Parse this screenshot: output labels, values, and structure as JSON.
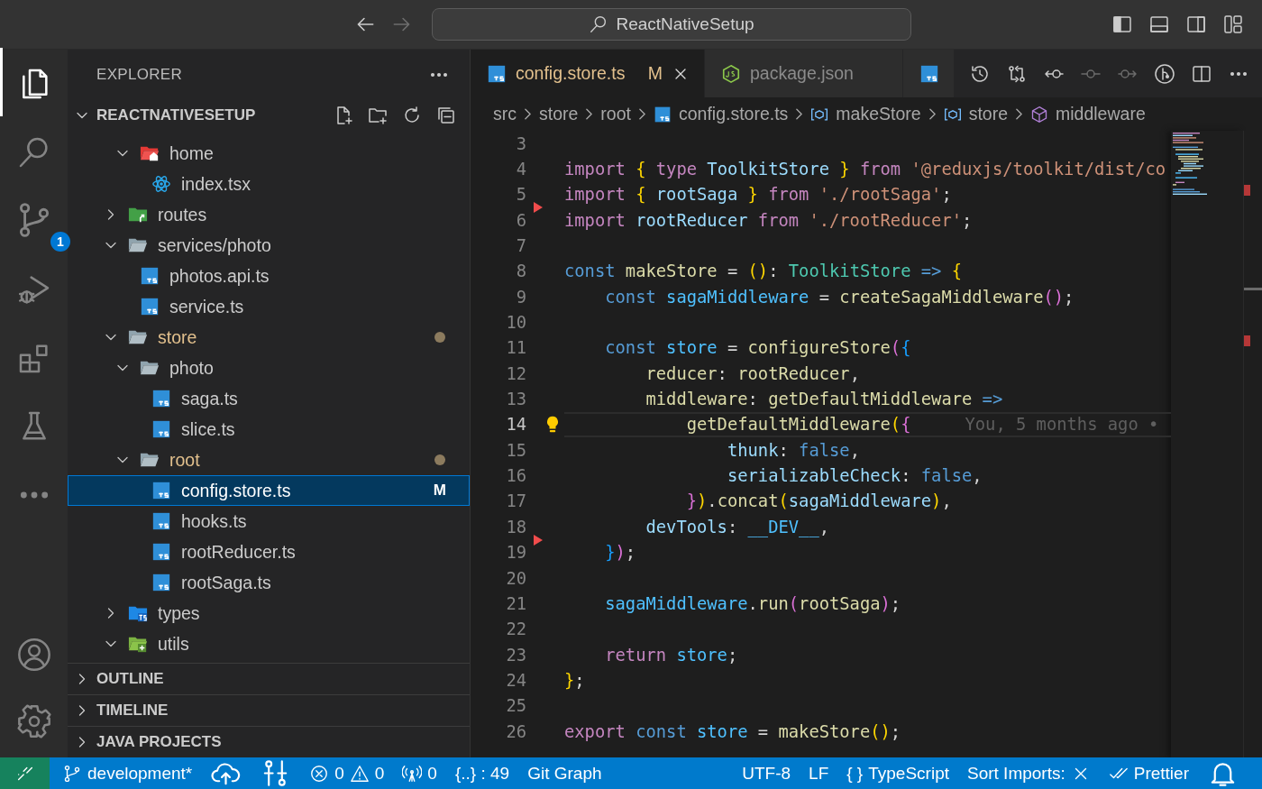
{
  "title_bar": {
    "nav": [
      {
        "kind": "back",
        "disabled": false
      },
      {
        "kind": "forward",
        "disabled": true
      }
    ],
    "command_center": "ReactNativeSetup",
    "layout_toggles": [
      {
        "kind": "primary-sidebar",
        "on": true
      },
      {
        "kind": "panel",
        "on": false
      },
      {
        "kind": "secondary-sidebar",
        "on": false
      },
      {
        "kind": "customize",
        "on": false
      }
    ]
  },
  "activity_bar": {
    "items": [
      {
        "kind": "explorer",
        "selected": true
      },
      {
        "kind": "search",
        "selected": false
      },
      {
        "kind": "source-control",
        "selected": false,
        "badge": "1"
      },
      {
        "kind": "run-debug",
        "selected": false
      },
      {
        "kind": "extensions",
        "selected": false
      },
      {
        "kind": "testing",
        "selected": false
      },
      {
        "kind": "more",
        "selected": false
      }
    ],
    "bottom": [
      {
        "kind": "account"
      },
      {
        "kind": "settings"
      }
    ]
  },
  "sidebar": {
    "title": "EXPLORER",
    "folder": {
      "title": "REACTNATIVESETUP",
      "expanded": true
    },
    "tree": [
      {
        "children": [
          {
            "name": "home",
            "kind": "home-folder",
            "expanded": true,
            "selected": false,
            "modified": false,
            "children": [
              {
                "name": "index.tsx",
                "kind": "react-file",
                "selected": false,
                "modified": false
              }
            ]
          }
        ]
      },
      {
        "name": "routes",
        "kind": "routes-folder",
        "expanded": false,
        "selected": false,
        "modified": false
      },
      {
        "name": "services/photo",
        "kind": "folder",
        "expanded": true,
        "selected": false,
        "modified": false,
        "children": [
          {
            "name": "photos.api.ts",
            "kind": "ts-file",
            "selected": false,
            "modified": false
          },
          {
            "name": "service.ts",
            "kind": "ts-file",
            "selected": false,
            "modified": false
          }
        ]
      },
      {
        "name": "store",
        "kind": "folder",
        "expanded": true,
        "selected": false,
        "modified": true,
        "children": [
          {
            "name": "photo",
            "kind": "folder",
            "expanded": true,
            "selected": false,
            "modified": false,
            "children": [
              {
                "name": "saga.ts",
                "kind": "ts-file",
                "selected": false,
                "modified": false
              },
              {
                "name": "slice.ts",
                "kind": "ts-file",
                "selected": false,
                "modified": false
              }
            ]
          },
          {
            "name": "root",
            "kind": "folder",
            "expanded": true,
            "selected": false,
            "modified": true,
            "children": [
              {
                "name": "config.store.ts",
                "kind": "ts-file",
                "selected": true,
                "modified": true,
                "badge": "M"
              },
              {
                "name": "hooks.ts",
                "kind": "ts-file",
                "selected": false,
                "modified": false
              },
              {
                "name": "rootReducer.ts",
                "kind": "ts-file",
                "selected": false,
                "modified": false
              },
              {
                "name": "rootSaga.ts",
                "kind": "ts-file",
                "selected": false,
                "modified": false
              }
            ]
          }
        ]
      },
      {
        "name": "types",
        "kind": "types-folder",
        "expanded": false,
        "selected": false,
        "modified": false
      },
      {
        "name": "utils",
        "kind": "utils-folder",
        "expanded": true,
        "selected": false,
        "modified": false
      }
    ],
    "sections": [
      {
        "title": "OUTLINE",
        "expanded": false
      },
      {
        "title": "TIMELINE",
        "expanded": false
      },
      {
        "title": "JAVA PROJECTS",
        "expanded": false
      }
    ]
  },
  "editor": {
    "tabs": [
      {
        "kind": "ts",
        "label": "config.store.ts",
        "status": "M",
        "modified": true,
        "selected": true
      },
      {
        "kind": "node",
        "label": "package.json",
        "modified": false,
        "selected": false
      },
      {
        "kind": "ts",
        "selected": false
      }
    ],
    "actions": [
      {
        "kind": "history",
        "disabled": false
      },
      {
        "kind": "compare",
        "disabled": false
      },
      {
        "kind": "git-back",
        "disabled": false
      },
      {
        "kind": "git-previous",
        "disabled": true
      },
      {
        "kind": "git-next",
        "disabled": true
      },
      {
        "kind": "git-graph",
        "disabled": false
      },
      {
        "kind": "split",
        "disabled": false
      },
      {
        "kind": "more",
        "disabled": false
      }
    ],
    "breadcrumbs": [
      {
        "kind": "folder",
        "text": "src"
      },
      {
        "kind": "folder",
        "text": "store"
      },
      {
        "kind": "folder",
        "text": "root"
      },
      {
        "kind": "ts",
        "text": "config.store.ts"
      },
      {
        "kind": "variable",
        "text": "makeStore"
      },
      {
        "kind": "variable",
        "text": "store"
      },
      {
        "kind": "method",
        "text": "middleware"
      }
    ],
    "lines": [
      {
        "number": "3",
        "current": false,
        "deleted_below": false
      },
      {
        "number": "4",
        "current": false,
        "deleted_below": false,
        "tokens": [
          {
            "kind": "ctl",
            "text": "import "
          },
          {
            "kind": "b1",
            "text": "{ "
          },
          {
            "kind": "ctl",
            "text": "type "
          },
          {
            "kind": "var",
            "text": "ToolkitStore "
          },
          {
            "kind": "b1",
            "text": "} "
          },
          {
            "kind": "ctl",
            "text": "from "
          },
          {
            "kind": "str",
            "text": "'@reduxjs/toolkit/dist/co"
          }
        ]
      },
      {
        "number": "5",
        "current": false,
        "deleted_below": true,
        "tokens": [
          {
            "kind": "ctl",
            "text": "import "
          },
          {
            "kind": "b1",
            "text": "{ "
          },
          {
            "kind": "var",
            "text": "rootSaga "
          },
          {
            "kind": "b1",
            "text": "} "
          },
          {
            "kind": "ctl",
            "text": "from "
          },
          {
            "kind": "str",
            "text": "'./rootSaga'"
          },
          {
            "kind": "p",
            "text": ";"
          }
        ]
      },
      {
        "number": "6",
        "current": false,
        "deleted_below": false,
        "tokens": [
          {
            "kind": "ctl",
            "text": "import "
          },
          {
            "kind": "var",
            "text": "rootReducer "
          },
          {
            "kind": "ctl",
            "text": "from "
          },
          {
            "kind": "str",
            "text": "'./rootReducer'"
          },
          {
            "kind": "p",
            "text": ";"
          }
        ]
      },
      {
        "number": "7",
        "current": false,
        "deleted_below": false
      },
      {
        "number": "8",
        "current": false,
        "deleted_below": false,
        "tokens": [
          {
            "kind": "kw",
            "text": "const "
          },
          {
            "kind": "fn",
            "text": "makeStore "
          },
          {
            "kind": "p",
            "text": "= "
          },
          {
            "kind": "b1",
            "text": "()"
          },
          {
            "kind": "p",
            "text": ": "
          },
          {
            "kind": "type",
            "text": "ToolkitStore "
          },
          {
            "kind": "kw",
            "text": "=> "
          },
          {
            "kind": "b1",
            "text": "{"
          }
        ]
      },
      {
        "number": "9",
        "current": false,
        "deleted_below": false,
        "tokens": [
          {
            "kind": "kw",
            "text": "    const "
          },
          {
            "kind": "const",
            "text": "sagaMiddleware "
          },
          {
            "kind": "p",
            "text": "= "
          },
          {
            "kind": "fn",
            "text": "createSagaMiddleware"
          },
          {
            "kind": "b2",
            "text": "()"
          },
          {
            "kind": "p",
            "text": ";"
          }
        ]
      },
      {
        "number": "10",
        "current": false,
        "deleted_below": false
      },
      {
        "number": "11",
        "current": false,
        "deleted_below": false,
        "tokens": [
          {
            "kind": "kw",
            "text": "    const "
          },
          {
            "kind": "const",
            "text": "store "
          },
          {
            "kind": "p",
            "text": "= "
          },
          {
            "kind": "fn",
            "text": "configureStore"
          },
          {
            "kind": "b2",
            "text": "("
          },
          {
            "kind": "b3",
            "text": "{"
          }
        ]
      },
      {
        "number": "12",
        "current": false,
        "deleted_below": false,
        "tokens": [
          {
            "kind": "fn",
            "text": "        reducer"
          },
          {
            "kind": "p",
            "text": ": "
          },
          {
            "kind": "fn",
            "text": "rootReducer"
          },
          {
            "kind": "p",
            "text": ","
          }
        ]
      },
      {
        "number": "13",
        "current": false,
        "deleted_below": false,
        "tokens": [
          {
            "kind": "fn",
            "text": "        middleware"
          },
          {
            "kind": "p",
            "text": ": "
          },
          {
            "kind": "fn",
            "text": "getDefaultMiddleware "
          },
          {
            "kind": "kw",
            "text": "=>"
          }
        ]
      },
      {
        "number": "14",
        "current": true,
        "deleted_below": false,
        "blame": "You, 5 months ago •",
        "tokens": [
          {
            "kind": "fn",
            "text": "            getDefaultMiddleware"
          },
          {
            "kind": "b1",
            "text": "("
          },
          {
            "kind": "b2",
            "text": "{"
          }
        ]
      },
      {
        "number": "15",
        "current": false,
        "deleted_below": false,
        "tokens": [
          {
            "kind": "var",
            "text": "                thunk"
          },
          {
            "kind": "p",
            "text": ": "
          },
          {
            "kind": "kw",
            "text": "false"
          },
          {
            "kind": "p",
            "text": ","
          }
        ]
      },
      {
        "number": "16",
        "current": false,
        "deleted_below": false,
        "tokens": [
          {
            "kind": "var",
            "text": "                serializableCheck"
          },
          {
            "kind": "p",
            "text": ": "
          },
          {
            "kind": "kw",
            "text": "false"
          },
          {
            "kind": "p",
            "text": ","
          }
        ]
      },
      {
        "number": "17",
        "current": false,
        "deleted_below": false,
        "tokens": [
          {
            "kind": "b2",
            "text": "            }"
          },
          {
            "kind": "b1",
            "text": ")"
          },
          {
            "kind": "p",
            "text": "."
          },
          {
            "kind": "fn",
            "text": "concat"
          },
          {
            "kind": "b1",
            "text": "("
          },
          {
            "kind": "var",
            "text": "sagaMiddleware"
          },
          {
            "kind": "b1",
            "text": ")"
          },
          {
            "kind": "p",
            "text": ","
          }
        ]
      },
      {
        "number": "18",
        "current": false,
        "deleted_below": true,
        "tokens": [
          {
            "kind": "var",
            "text": "        devTools"
          },
          {
            "kind": "p",
            "text": ": "
          },
          {
            "kind": "const",
            "text": "__DEV__"
          },
          {
            "kind": "p",
            "text": ","
          }
        ]
      },
      {
        "number": "19",
        "current": false,
        "deleted_below": false,
        "tokens": [
          {
            "kind": "b3",
            "text": "    }"
          },
          {
            "kind": "b2",
            "text": ")"
          },
          {
            "kind": "p",
            "text": ";"
          }
        ]
      },
      {
        "number": "20",
        "current": false,
        "deleted_below": false
      },
      {
        "number": "21",
        "current": false,
        "deleted_below": false,
        "tokens": [
          {
            "kind": "const",
            "text": "    sagaMiddleware"
          },
          {
            "kind": "p",
            "text": "."
          },
          {
            "kind": "fn",
            "text": "run"
          },
          {
            "kind": "b2",
            "text": "("
          },
          {
            "kind": "fn",
            "text": "rootSaga"
          },
          {
            "kind": "b2",
            "text": ")"
          },
          {
            "kind": "p",
            "text": ";"
          }
        ]
      },
      {
        "number": "22",
        "current": false,
        "deleted_below": false
      },
      {
        "number": "23",
        "current": false,
        "deleted_below": false,
        "tokens": [
          {
            "kind": "ctl",
            "text": "    return "
          },
          {
            "kind": "const",
            "text": "store"
          },
          {
            "kind": "p",
            "text": ";"
          }
        ]
      },
      {
        "number": "24",
        "current": false,
        "deleted_below": false,
        "tokens": [
          {
            "kind": "b1",
            "text": "}"
          },
          {
            "kind": "p",
            "text": ";"
          }
        ]
      },
      {
        "number": "25",
        "current": false,
        "deleted_below": false
      },
      {
        "number": "26",
        "current": false,
        "deleted_below": false,
        "tokens": [
          {
            "kind": "ctl",
            "text": "export "
          },
          {
            "kind": "kw",
            "text": "const "
          },
          {
            "kind": "const",
            "text": "store "
          },
          {
            "kind": "p",
            "text": "= "
          },
          {
            "kind": "fn",
            "text": "makeStore"
          },
          {
            "kind": "b1",
            "text": "()"
          },
          {
            "kind": "p",
            "text": ";"
          }
        ]
      }
    ]
  },
  "status_bar": {
    "left": [
      {
        "kind": "remote"
      },
      {
        "kind": "branch",
        "text": "development*"
      },
      {
        "kind": "publish"
      },
      {
        "kind": "compare"
      },
      {
        "kind": "problems",
        "errors": "0",
        "warnings": "0"
      },
      {
        "kind": "ports",
        "text": "0"
      },
      {
        "kind": "plain",
        "text": "{..} : 49"
      },
      {
        "kind": "plain",
        "text": "Git Graph"
      }
    ],
    "right": [
      {
        "kind": "plain",
        "text": "UTF-8"
      },
      {
        "kind": "plain",
        "text": "LF"
      },
      {
        "kind": "language",
        "glyph": "{ }",
        "text": "TypeScript"
      },
      {
        "kind": "sort-imports",
        "text": "Sort Imports:"
      },
      {
        "kind": "prettier",
        "text": "Prettier"
      },
      {
        "kind": "bell"
      }
    ]
  }
}
